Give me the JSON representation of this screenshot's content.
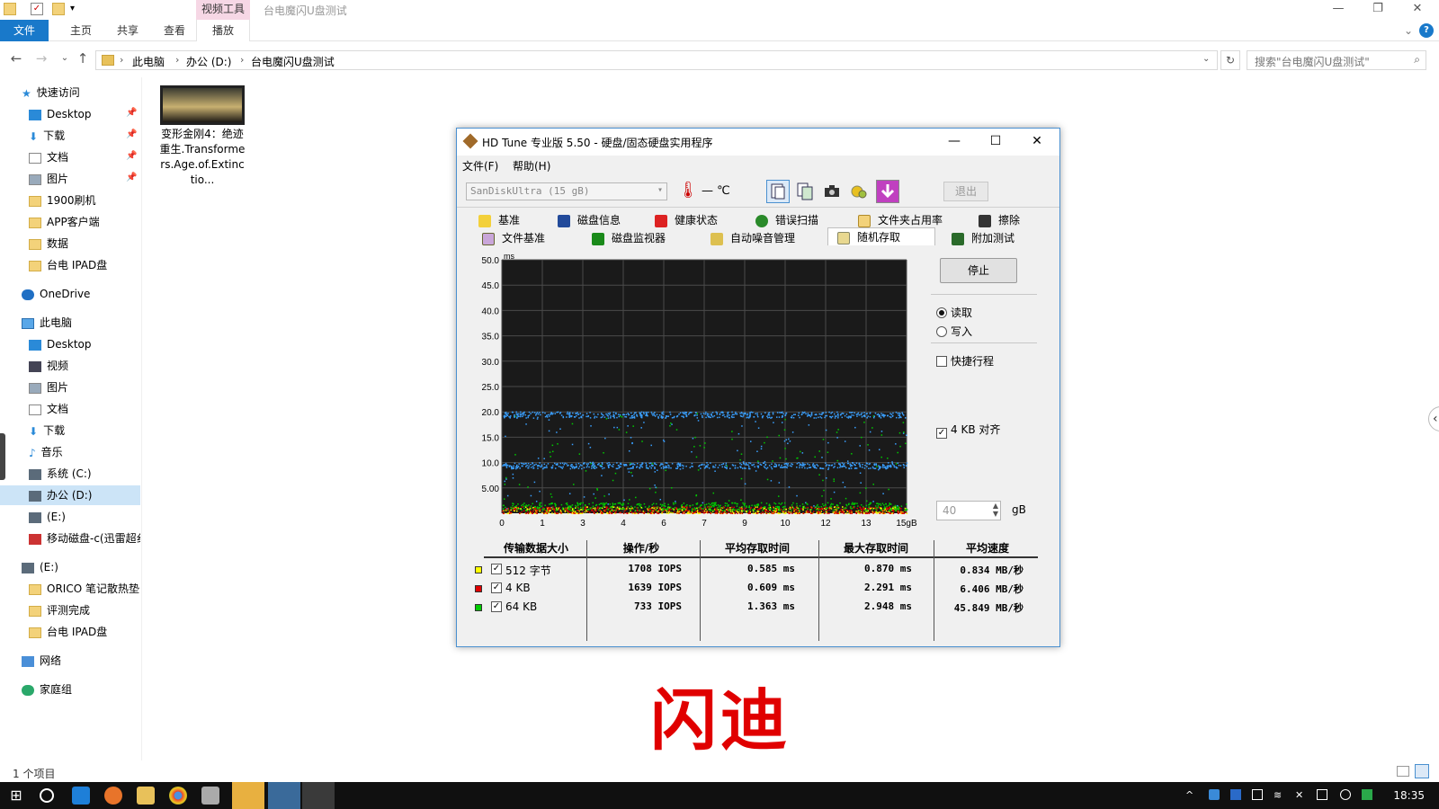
{
  "explorer": {
    "context_tab_header": "视频工具",
    "window_title": "台电魔闪U盘测试",
    "ribbon_tabs": [
      "文件",
      "主页",
      "共享",
      "查看",
      "播放"
    ],
    "breadcrumbs": [
      "此电脑",
      "办公 (D:)",
      "台电魔闪U盘测试"
    ],
    "search_placeholder": "搜索\"台电魔闪U盘测试\"",
    "nav": {
      "quick_access": "快速访问",
      "quick_items": [
        "Desktop",
        "下载",
        "文档",
        "图片",
        "1900刷机",
        "APP客户端",
        "数据",
        "台电 IPAD盘"
      ],
      "onedrive": "OneDrive",
      "this_pc": "此电脑",
      "pc_items": [
        "Desktop",
        "视频",
        "图片",
        "文档",
        "下载",
        "音乐",
        "系统 (C:)",
        "办公 (D:)",
        "(E:)",
        "移动磁盘-c(迅雷超纟"
      ],
      "e_drive": "(E:)",
      "e_items": [
        "ORICO 笔记散热垫",
        "评测完成",
        "台电 IPAD盘"
      ],
      "network": "网络",
      "homegroup": "家庭组"
    },
    "file_name": "变形金刚4：绝迹重生.Transformers.Age.of.Extinctio...",
    "status": "1 个项目"
  },
  "hdtune": {
    "title": "HD Tune 专业版 5.50 - 硬盘/固态硬盘实用程序",
    "menu": [
      "文件(F)",
      "帮助(H)"
    ],
    "drive": "SanDiskUltra (15 gB)",
    "temp": "— ℃",
    "exit": "退出",
    "tabs_row1": [
      "基准",
      "磁盘信息",
      "健康状态",
      "错误扫描",
      "文件夹占用率",
      "擦除"
    ],
    "tabs_row2": [
      "文件基准",
      "磁盘监视器",
      "自动噪音管理",
      "随机存取",
      "附加测试"
    ],
    "stop": "停止",
    "read": "读取",
    "write": "写入",
    "short_stroke": "快捷行程",
    "gb_value": "40",
    "gb_unit": "gB",
    "align": "4 KB 对齐",
    "results": {
      "headers": [
        "传输数据大小",
        "操作/秒",
        "平均存取时间",
        "最大存取时间",
        "平均速度"
      ],
      "rows": [
        {
          "size": "512 字节",
          "color": "#ffff00",
          "iops": "1708 IOPS",
          "avg": "0.585 ms",
          "max": "0.870 ms",
          "speed": "0.834 MB/秒"
        },
        {
          "size": "4 KB",
          "color": "#e00000",
          "iops": "1639 IOPS",
          "avg": "0.609 ms",
          "max": "2.291 ms",
          "speed": "6.406 MB/秒"
        },
        {
          "size": "64 KB",
          "color": "#00cc00",
          "iops": "733 IOPS",
          "avg": "1.363 ms",
          "max": "2.948 ms",
          "speed": "45.849 MB/秒"
        }
      ]
    }
  },
  "chart_data": {
    "type": "scatter",
    "title": "",
    "ylabel": "ms",
    "xlabel": "",
    "y_ticks": [
      "50.0",
      "45.0",
      "40.0",
      "35.0",
      "30.0",
      "25.0",
      "20.0",
      "15.0",
      "10.0",
      "5.00"
    ],
    "x_ticks": [
      "0",
      "1",
      "3",
      "4",
      "6",
      "7",
      "9",
      "10",
      "12",
      "13",
      "15gB"
    ],
    "ylim": [
      0,
      50
    ],
    "xlim": [
      0,
      15
    ],
    "series": [
      {
        "name": "512 字节",
        "color": "#ffff00",
        "band_ms": 0.6
      },
      {
        "name": "4 KB",
        "color": "#e00000",
        "band_ms": 0.6
      },
      {
        "name": "64 KB",
        "color": "#00cc00",
        "band_ms": 1.4
      },
      {
        "name": "",
        "color": "#3aa0ff",
        "band_ms": 9.5
      },
      {
        "name": "",
        "color": "#3aa0ff",
        "band_ms": 19.5
      }
    ],
    "grid": true,
    "background": "#1a1a1a"
  },
  "watermark": "闪迪",
  "taskbar": {
    "clock": "18:35"
  }
}
